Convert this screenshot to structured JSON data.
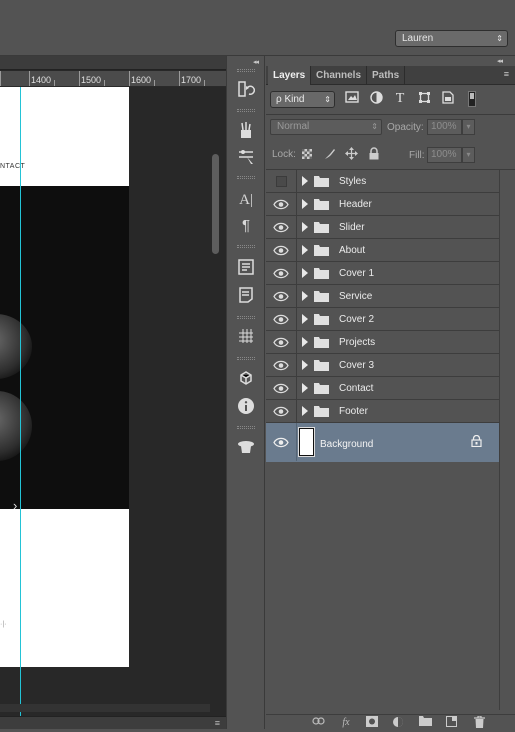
{
  "workspace": {
    "label": "Lauren",
    "arrow": "⇕"
  },
  "ruler": {
    "ticks": [
      "1400",
      "1500",
      "1600",
      "1700"
    ]
  },
  "document": {
    "contact_text": "NTACT",
    "slider_arrow": "›",
    "side_mark": "·|·"
  },
  "panel": {
    "tabs": [
      {
        "label": "Layers"
      },
      {
        "label": "Channels"
      },
      {
        "label": "Paths"
      }
    ],
    "menu_icon": "≡",
    "collapse_icon": "◂◂",
    "filter": {
      "kind_label": "ρ Kind",
      "arrow": "⇕"
    },
    "blend": {
      "mode": "Normal",
      "arrow": "⇕"
    },
    "opacity": {
      "label": "Opacity:",
      "value": "100%",
      "arrow": "▾"
    },
    "lock": {
      "label": "Lock:"
    },
    "fill": {
      "label": "Fill:",
      "value": "100%",
      "arrow": "▾"
    },
    "layers": [
      {
        "name": "Styles",
        "visible": false
      },
      {
        "name": "Header",
        "visible": true
      },
      {
        "name": "Slider",
        "visible": true
      },
      {
        "name": "About",
        "visible": true
      },
      {
        "name": "Cover 1",
        "visible": true
      },
      {
        "name": "Service",
        "visible": true
      },
      {
        "name": "Cover 2",
        "visible": true
      },
      {
        "name": "Projects",
        "visible": true
      },
      {
        "name": "Cover 3",
        "visible": true
      },
      {
        "name": "Contact",
        "visible": true
      },
      {
        "name": "Footer",
        "visible": true
      }
    ],
    "background_layer": {
      "name": "Background",
      "visible": true,
      "locked": true
    },
    "bottom_icons": [
      "link-icon",
      "fx-icon",
      "mask-icon",
      "adjustment-icon",
      "group-folder-icon",
      "new-layer-icon",
      "trash-icon"
    ]
  },
  "colors": {
    "guide": "#23c3d6",
    "selected_layer": "#6a7b8e",
    "panel_bg": "#535353"
  }
}
